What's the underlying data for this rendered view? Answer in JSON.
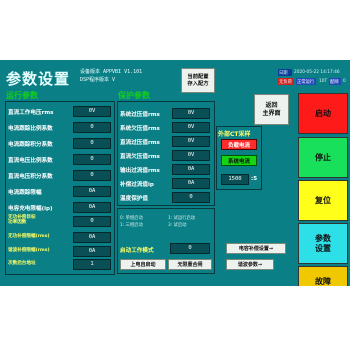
{
  "header": {
    "title": "参数设置",
    "version_line1": "设备版本    APPVBI V1.101",
    "version_line2": "DSP程序版本 V",
    "save_config": "当前配置\n存入配方",
    "date_label": "日期",
    "date_value": "2020-05-22 14:17:46",
    "tag_state": "无负荷",
    "tag_mode": "正常运行",
    "ip": "10T",
    "ip_label": "配网",
    "ip_num": "0"
  },
  "run_params": {
    "title": "运行参数",
    "rows": [
      {
        "label": "直流工作电压rms",
        "value": "0V"
      },
      {
        "label": "电流跟踪比例系数",
        "value": "0"
      },
      {
        "label": "电流跟踪积分系数",
        "value": "0"
      },
      {
        "label": "直流电压比例系数",
        "value": "0"
      },
      {
        "label": "直流电压积分系数",
        "value": "0"
      },
      {
        "label": "电流跟踪限幅",
        "value": "0A"
      },
      {
        "label": "电容充电限幅(ip)",
        "value": "0A"
      }
    ],
    "extra_rows": [
      {
        "label": "无功补偿目标\n功率因数",
        "value": "0"
      },
      {
        "label": "无功补偿限幅(rms)",
        "value": "0A"
      },
      {
        "label": "谐波补偿限幅(rms)",
        "value": "0A"
      },
      {
        "label": "次数后台地址",
        "value": "1"
      }
    ]
  },
  "protect_params": {
    "title": "保护参数",
    "rows": [
      {
        "label": "系统过压值rms",
        "value": "0V"
      },
      {
        "label": "系统欠压值rms",
        "value": "0V"
      },
      {
        "label": "直流过压值rms",
        "value": "0V"
      },
      {
        "label": "直流欠压值rms",
        "value": "0V"
      },
      {
        "label": "输出过流值rms",
        "value": "0A"
      },
      {
        "label": "补偿过流值ip",
        "value": "0A"
      },
      {
        "label": "温度保护值",
        "value": "0"
      }
    ]
  },
  "start_mode": {
    "options_left": [
      "0: 单相启动",
      "1: 三相启动"
    ],
    "options_right": [
      "1: 试运行启动",
      "3: 试启动"
    ],
    "label": "启动工作模式",
    "value": "0",
    "auto_start": "上电自启动",
    "no_restart": "无限重合闸"
  },
  "ct": {
    "title": "外部CT采样",
    "btn_capacitor": "负载电流",
    "btn_system": "系统电流",
    "ratio_value": "1500",
    "ratio_suffix": ":5"
  },
  "nav": {
    "back_home": "返回\n主界面",
    "cap_settings": "电容补偿设置→",
    "harmonic_params": "谐波参数→"
  },
  "side_buttons": {
    "start": "启动",
    "stop": "停止",
    "reset": "复位",
    "params": "参数\n设置",
    "faults": "故障\n列表"
  },
  "colors": {
    "bg": "#0b7f86",
    "start": "#ff1a1a",
    "stop": "#19e05a",
    "reset": "#ffff1a",
    "params": "#2de0e8",
    "faults": "#f0c800",
    "ct_red": "#ff2a2a",
    "ct_green": "#14d414"
  }
}
